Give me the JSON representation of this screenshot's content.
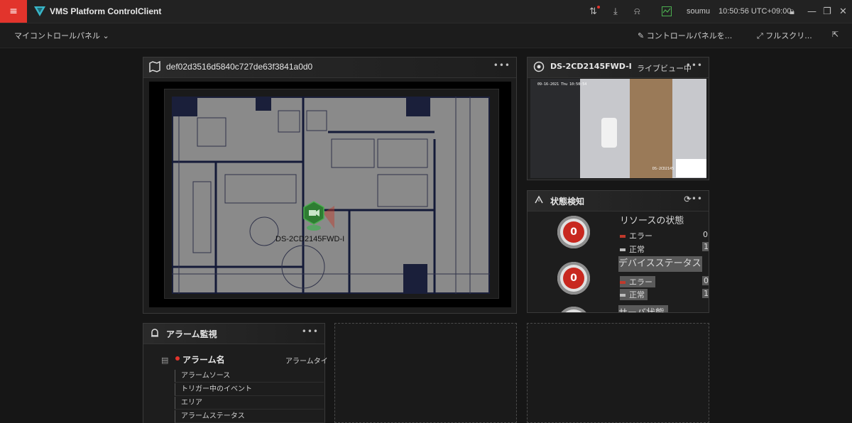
{
  "app": {
    "title": "VMS Platform ControlClient",
    "user": "soumu",
    "time": "10:50:56 UTC+09:00",
    "menu_glyph": "≡"
  },
  "subbar": {
    "panel_name": "マイコントロールパネル",
    "edit": "コントロールパネルを...",
    "fullscreen": "フルスクリ..."
  },
  "map_panel": {
    "title": "def02d3516d5840c727de63f3841a0d0",
    "camera_label": "DS-2CD2145FWD-I"
  },
  "camera_panel": {
    "title": "DS-2CD2145FWD-I",
    "status": "ライブビュー中",
    "osd": "09-16-2021 Thu 10:50:54",
    "osd_name": "DS-2CD2145"
  },
  "status_panel": {
    "title": "状態検知",
    "resource_heading": "リソースの状態",
    "error": "エラー",
    "normal": "正常",
    "device_heading": "デバイスステータス",
    "server_heading": "サーバ状態",
    "gauge1": "0",
    "gauge2": "0",
    "count1_error": "0",
    "count1_normal": "1",
    "count2_error": "0",
    "count2_normal": "1"
  },
  "alarm_panel": {
    "title": "アラーム監視",
    "col_name": "アラーム名",
    "col_type": "アラームタイ",
    "rows": [
      "アラームソース",
      "トリガー中のイベント",
      "エリア",
      "アラームステータス"
    ]
  },
  "colors": {
    "accent": "#e2342c",
    "logo": "#39b7c9",
    "marker": "#2e7d32"
  }
}
